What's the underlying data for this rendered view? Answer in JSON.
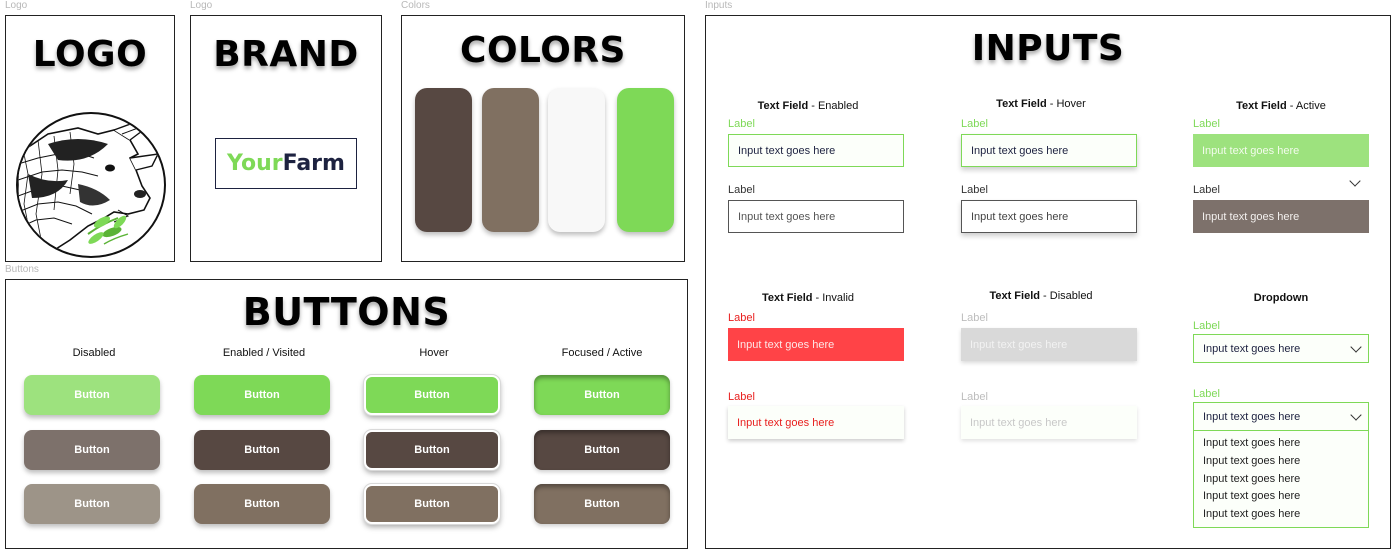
{
  "frame_labels": {
    "logo1": "Logo",
    "logo2": "Logo",
    "colors": "Colors",
    "inputs": "Inputs",
    "buttons": "Buttons"
  },
  "logo": {
    "title": "LOGO"
  },
  "brand": {
    "title": "BRAND",
    "word1": "Your",
    "word2": "Farm"
  },
  "colors": {
    "title": "COLORS",
    "swatches": [
      "#574842",
      "#807061",
      "#f8f8f8",
      "#7ed957"
    ]
  },
  "buttons": {
    "title": "BUTTONS",
    "states": [
      "Disabled",
      "Enabled / Visited",
      "Hover",
      "Focused / Active"
    ],
    "label": "Button"
  },
  "inputs": {
    "title": "INPUTS",
    "field_word": "Text Field",
    "placeholder": "Input text goes here",
    "label": "Label",
    "enabled": "- Enabled",
    "hover": "- Hover",
    "active": "- Active",
    "invalid": "- Invalid",
    "disabled": "- Disabled",
    "dropdown": "Dropdown",
    "dropdown_options": [
      "Input text goes here",
      "Input text goes here",
      "Input text goes here",
      "Input text goes here",
      "Input text goes here"
    ]
  },
  "palette": {
    "green": "#7ed957",
    "green_light": "#9de27e",
    "brown_dark": "#574842",
    "brown_mid": "#807061",
    "grey_brown": "#7d716b",
    "taupe": "#9d9488",
    "red": "#ff4347",
    "navy": "#1d2240"
  }
}
